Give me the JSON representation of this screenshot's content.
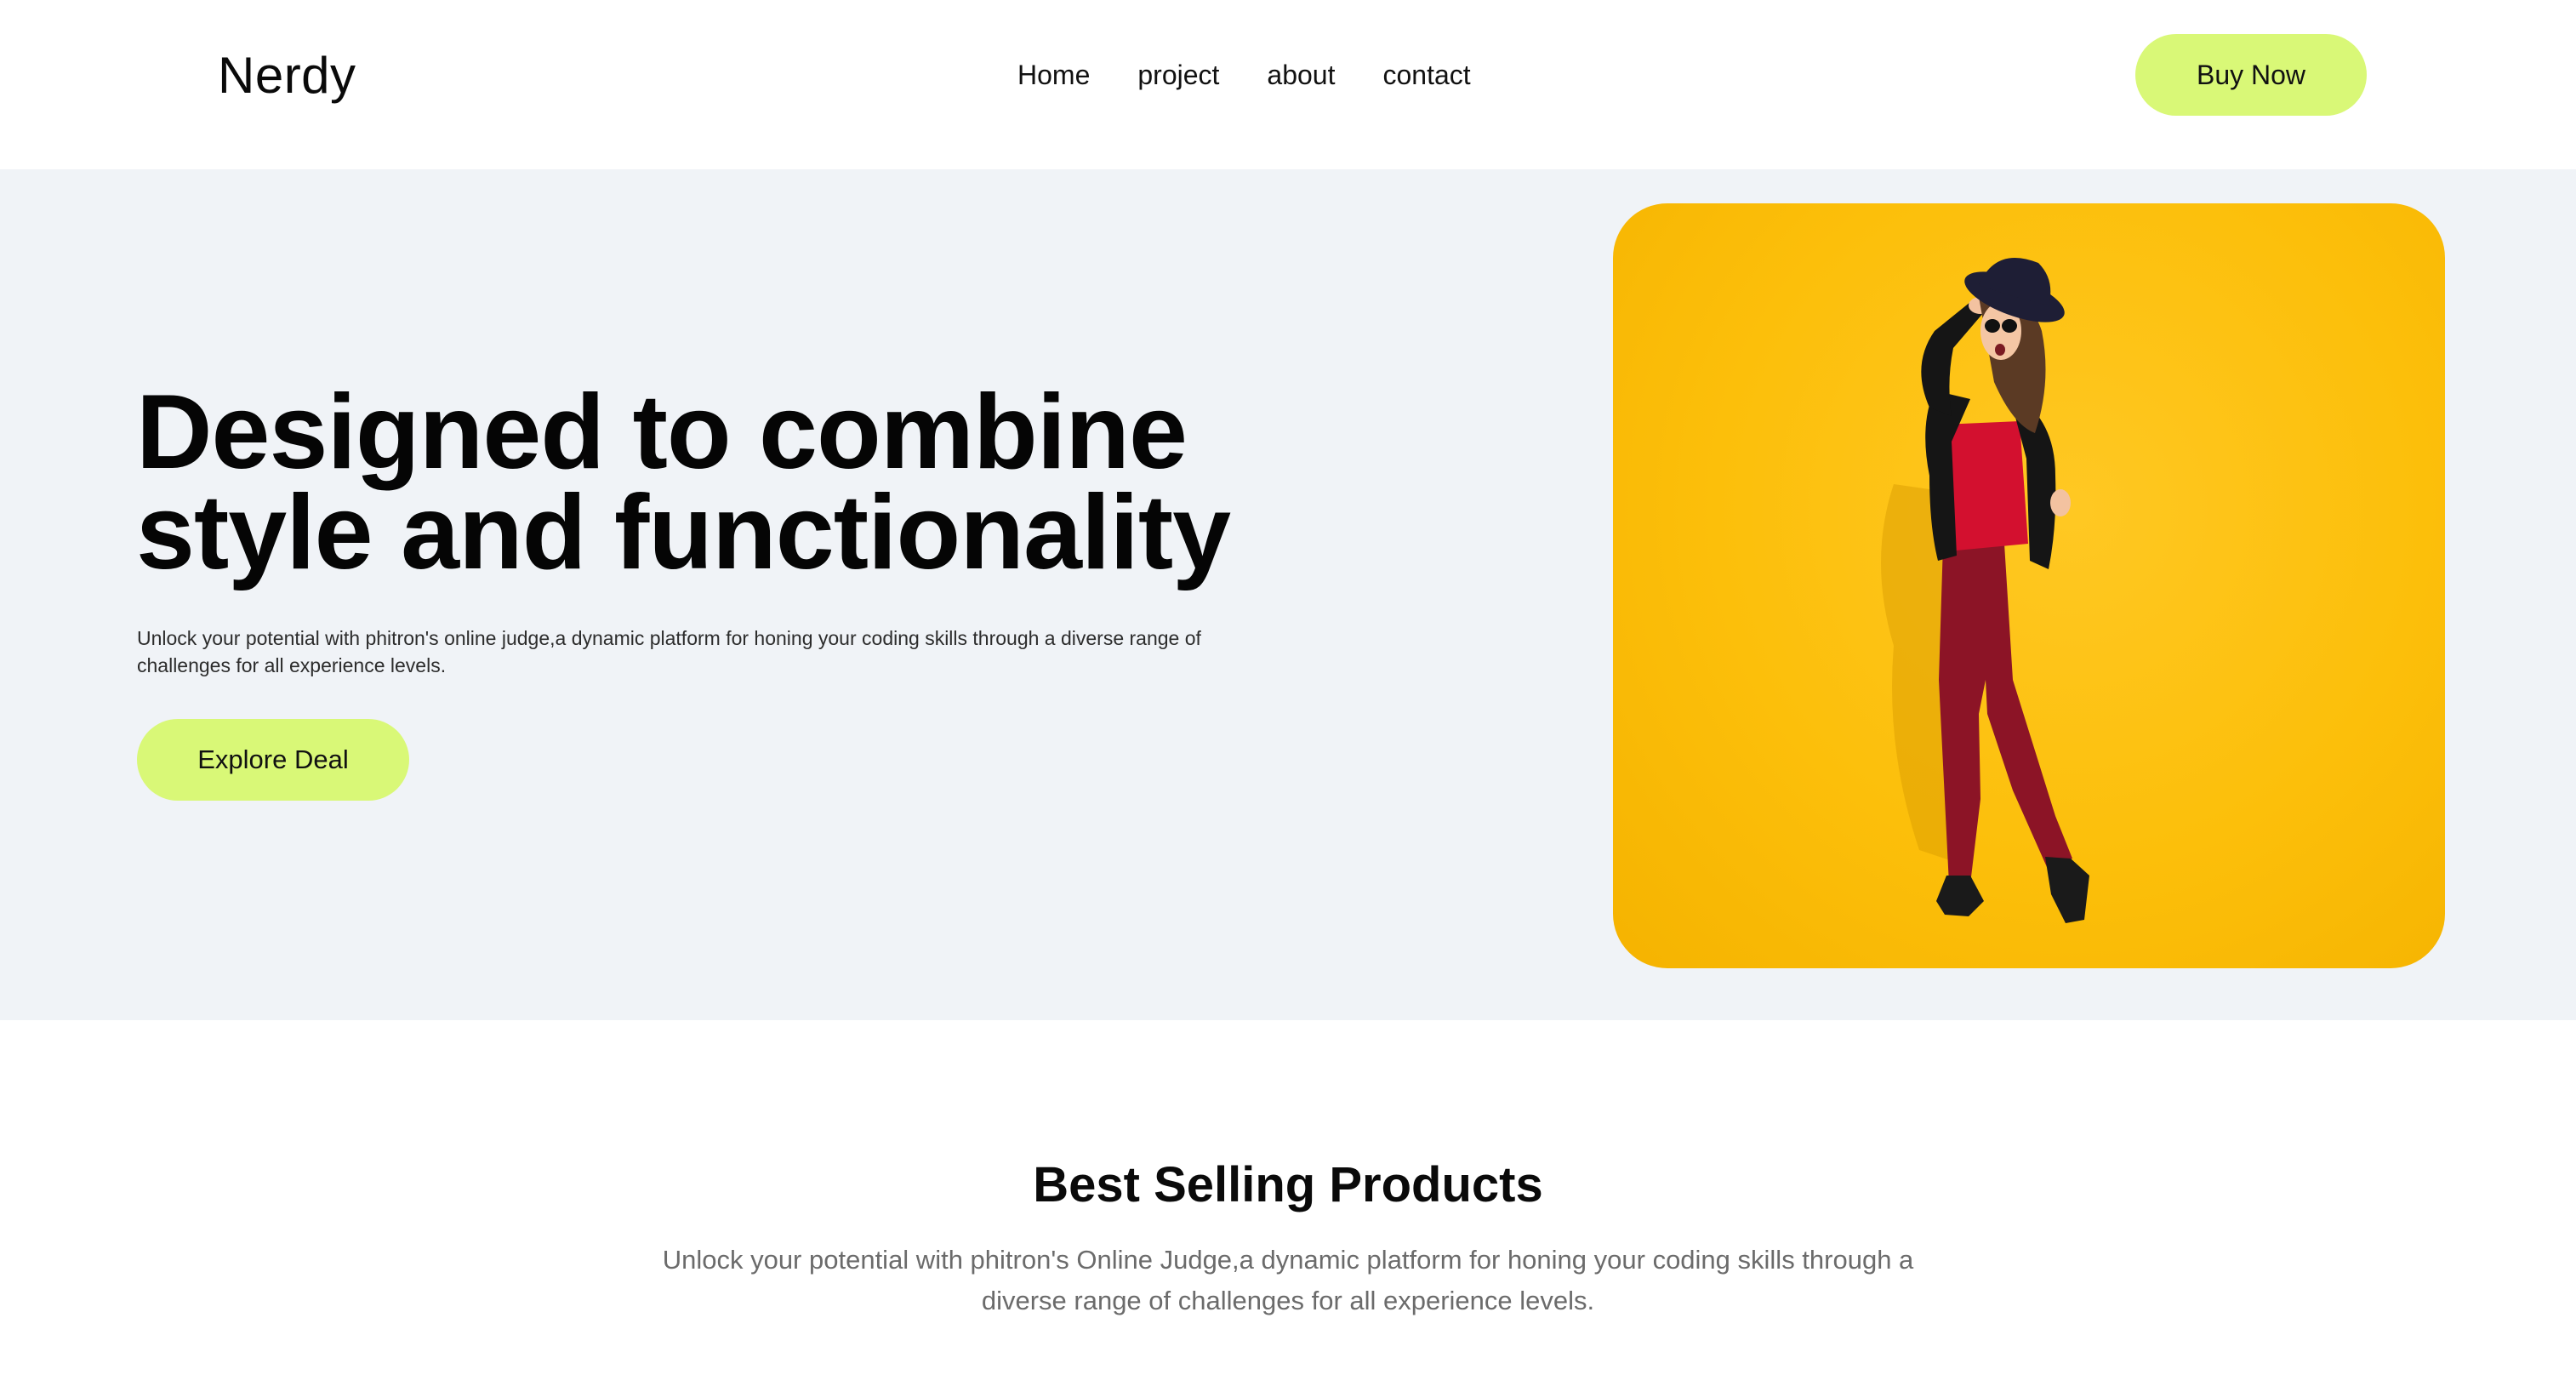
{
  "header": {
    "logo": "Nerdy",
    "nav": [
      {
        "label": "Home"
      },
      {
        "label": "project"
      },
      {
        "label": "about"
      },
      {
        "label": "contact"
      }
    ],
    "buy_button": "Buy Now"
  },
  "hero": {
    "title_line1": "Designed to combine",
    "title_line2": "style and functionality",
    "description": "Unlock your potential with phitron's online judge,a dynamic platform for honing your coding skills through a diverse range of challenges for all experience levels.",
    "cta": "Explore Deal",
    "image_bg_color": "#fcbf0a"
  },
  "products": {
    "title": "Best Selling Products",
    "description": "Unlock your potential with phitron's Online Judge,a dynamic platform for honing your coding skills through a diverse range of challenges for all experience levels."
  },
  "colors": {
    "accent": "#d9f877",
    "hero_bg": "#f0f3f7",
    "text": "#050505",
    "muted": "#6b6b6b"
  }
}
